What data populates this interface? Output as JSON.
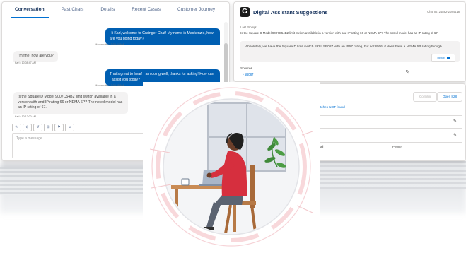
{
  "tabs": [
    "Conversation",
    "Past Chats",
    "Details",
    "Recent Cases",
    "Customer Journey"
  ],
  "chat": {
    "messages": [
      {
        "side": "out",
        "text": "Hi Karl, welcome to Grainger Chat! My name is Mackenzie, how are you doing today?",
        "meta": "Mackenzie • 10:08:24 AM"
      },
      {
        "side": "in",
        "text": "I'm fine, how are you?",
        "meta": "Karl • 10:08:47 AM"
      },
      {
        "side": "out",
        "text": "That's great to hear! I am doing well, thanks for asking! How can I assist you today?",
        "meta": "Mackenzie • 10:08:59 AM"
      },
      {
        "side": "in",
        "text": "Is the Square D Model 9007C54B2 limit switch available in a version with and IP rating 66 or NEMA 6P? The noted model has an IP rating of 67.",
        "meta": "Karl • 10:12:00 AM"
      }
    ],
    "toolbar": [
      "✎",
      "⊘",
      "↺",
      "⊞",
      "⚑",
      "☺"
    ],
    "composer_placeholder": "Type a message..."
  },
  "suggestions": {
    "title": "Digital Assistant Suggestions",
    "chat_id": "Chat ID: 24882-2084418",
    "last_prompt_label": "Last Prompt:",
    "last_prompt": "Is the Square D Model 9007C54B2 limit switch available in a version with and IP rating 66 or NEMA 6P? The noted model has an IP rating of 67.",
    "answer": "Absolutely, we have the Square D limit switch SKU: 5B087 with an IP67 rating, but not IP66; it does have a NEMA 6P rating though.",
    "insert_label": "Insert",
    "sources_label": "Sources",
    "source_link": "5B087"
  },
  "contact": {
    "confirm_label": "Confirm",
    "open_label": "Open 828",
    "link_text": "tches NOT found",
    "email_label": "ail",
    "phone_label": "Phone"
  },
  "colors": {
    "brand_blue": "#005fb2",
    "accent_red": "#f2b8bd",
    "skin": "#6b3f2a",
    "shirt": "#d62f3e"
  }
}
